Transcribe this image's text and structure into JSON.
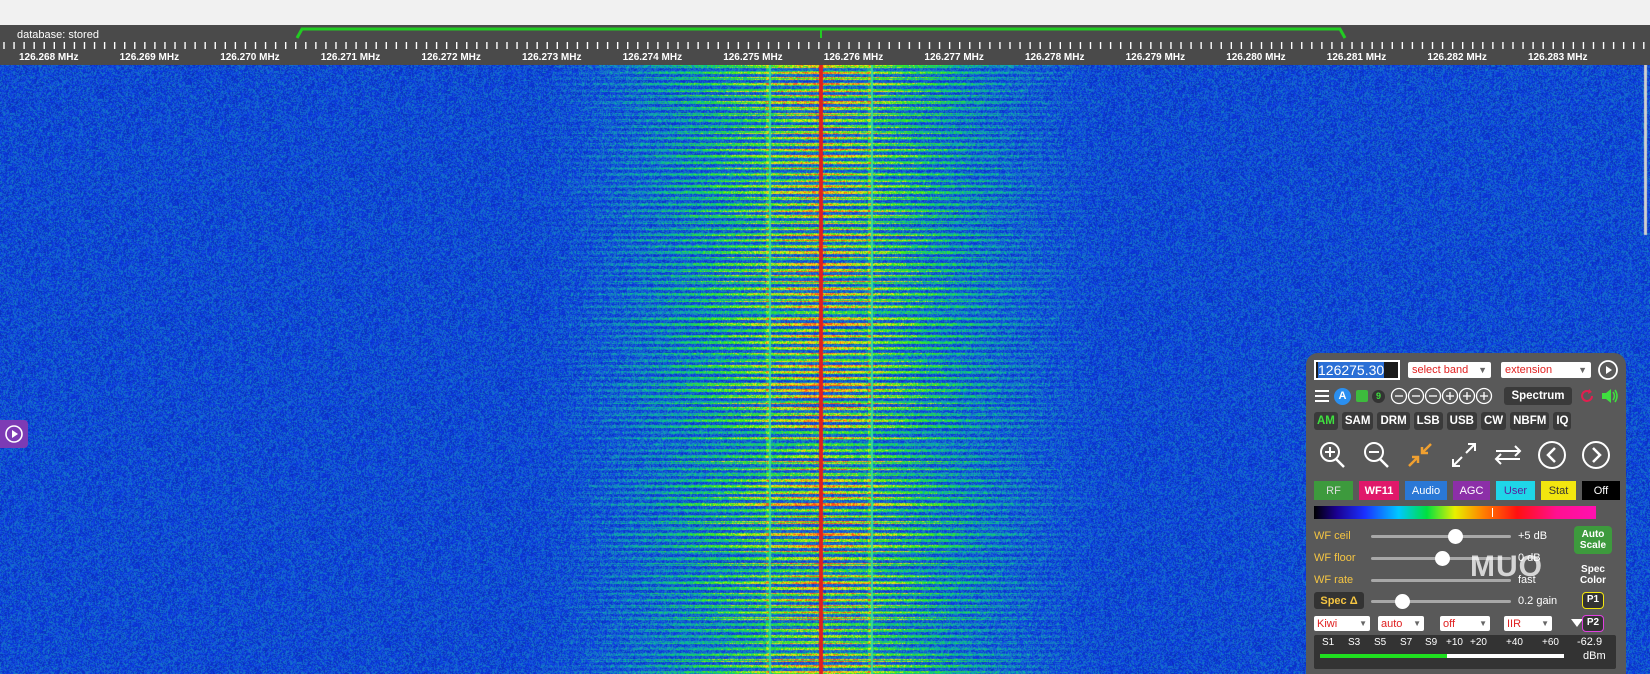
{
  "header": {
    "database_label": "database: stored"
  },
  "scale": {
    "labels": [
      "126.268 MHz",
      "126.269 MHz",
      "126.270 MHz",
      "126.271 MHz",
      "126.272 MHz",
      "126.273 MHz",
      "126.274 MHz",
      "126.275 MHz",
      "126.276 MHz",
      "126.277 MHz",
      "126.278 MHz",
      "126.279 MHz",
      "126.280 MHz",
      "126.281 MHz",
      "126.282 MHz",
      "126.283 MHz"
    ],
    "passband_color": "#22cc22"
  },
  "waterfall": {
    "center_color": "#e02020",
    "carrier_color": "#33d6a0"
  },
  "side": {
    "play_icon": "play-icon"
  },
  "panel": {
    "frequency": "126275.30",
    "band_select": "select band",
    "extension_select": "extension",
    "spectrum_label": "Spectrum",
    "modes": [
      "AM",
      "SAM",
      "DRM",
      "LSB",
      "USB",
      "CW",
      "NBFM",
      "IQ"
    ],
    "active_mode": "AM",
    "badge_a": "A",
    "badge_9": "9",
    "tabs": [
      {
        "label": "RF",
        "bg": "#3d9a3d",
        "fg": "#dddddd"
      },
      {
        "label": "WF11",
        "bg": "#e0186a",
        "fg": "#ffffff"
      },
      {
        "label": "Audio",
        "bg": "#2a78d6",
        "fg": "#ffffff"
      },
      {
        "label": "AGC",
        "bg": "#8c2fa8",
        "fg": "#ffffff"
      },
      {
        "label": "User",
        "bg": "#1fd6e8",
        "fg": "#5a1a9a"
      },
      {
        "label": "Stat",
        "bg": "#f2e60f",
        "fg": "#333333"
      },
      {
        "label": "Off",
        "bg": "#000000",
        "fg": "#ffffff"
      }
    ],
    "wf_ceil": {
      "label": "WF ceil",
      "value": "+5 dB",
      "level": 0.6
    },
    "wf_floor": {
      "label": "WF floor",
      "value": "0 dB",
      "level": 0.51
    },
    "wf_rate": {
      "label": "WF rate",
      "value": "fast"
    },
    "spec_delta": {
      "label": "Spec Δ",
      "value": "0.2 gain",
      "level": 0.22
    },
    "auto_scale": "Auto Scale",
    "spec_color": "Spec Color",
    "p1": "P1",
    "p2": "P2",
    "dropdowns": [
      "Kiwi",
      "auto",
      "off",
      "IIR"
    ],
    "smeter": {
      "labels": [
        "S1",
        "S3",
        "S5",
        "S7",
        "S9",
        "+10",
        "+20",
        "+40",
        "+60"
      ],
      "reading": "-62.9",
      "unit": "dBm",
      "level": 0.52
    }
  },
  "watermark": "MUO"
}
